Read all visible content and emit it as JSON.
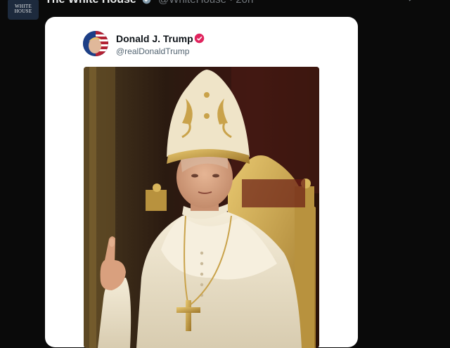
{
  "outer_post": {
    "avatar_lines": [
      "WHITE",
      "HOUSE"
    ],
    "display_name": "The White House",
    "handle": "@WhiteHouse · 20h",
    "more_icon": "more-icon",
    "badge_icon": "verified-badge-icon"
  },
  "embedded_post": {
    "display_name": "Donald J. Trump",
    "handle": "@realDonaldTrump",
    "badge_icon": "verified-badge-icon",
    "badge_color": "#e0245e",
    "image_alt": "Portrait of a man in papal vestments and a gold-embroidered mitre seated on a golden throne, raising one finger"
  },
  "colors": {
    "page_bg": "#0a0a0a",
    "card_bg": "#ffffff",
    "gold": "#c9a24a",
    "vestment": "#efe6d0"
  }
}
